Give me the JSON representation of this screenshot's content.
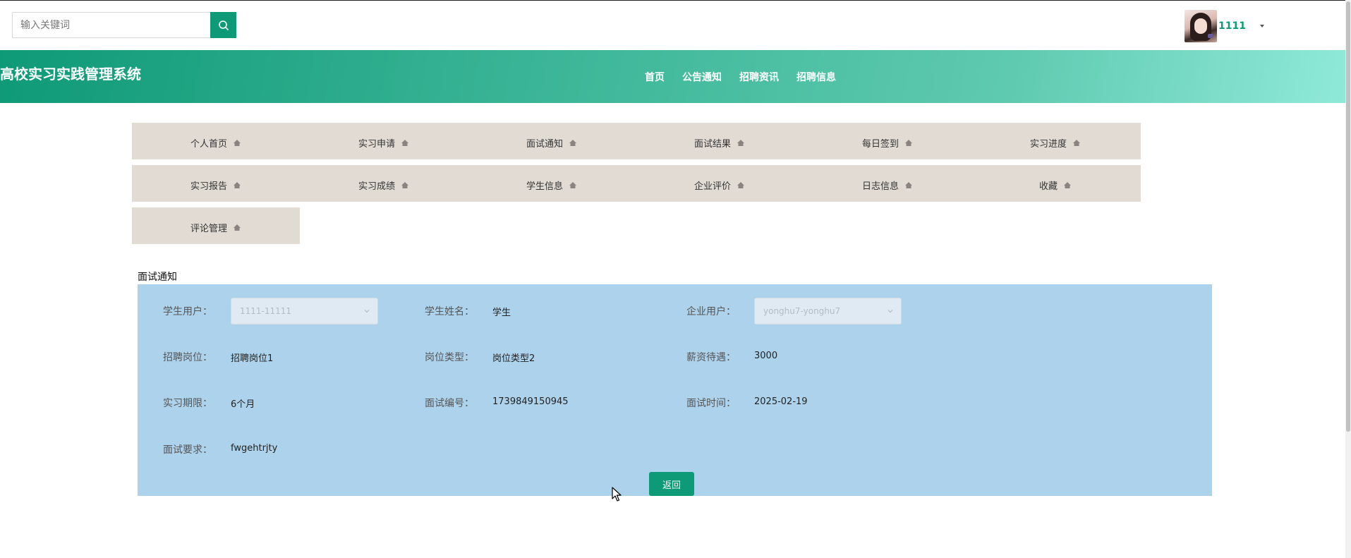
{
  "search": {
    "placeholder": "输入关键词"
  },
  "user": {
    "name": "1111"
  },
  "site": {
    "title": "高校实习实践管理系统"
  },
  "top_nav": [
    "首页",
    "公告通知",
    "招聘资讯",
    "招聘信息"
  ],
  "menu": [
    "个人首页",
    "实习申请",
    "面试通知",
    "面试结果",
    "每日签到",
    "实习进度",
    "实习报告",
    "实习成绩",
    "学生信息",
    "企业评价",
    "日志信息",
    "收藏",
    "评论管理"
  ],
  "section": {
    "title": "面试通知"
  },
  "form": {
    "student_user_label": "学生用户：",
    "student_user_value": "1111-11111",
    "student_name_label": "学生姓名：",
    "student_name_value": "学生",
    "company_user_label": "企业用户：",
    "company_user_value": "yonghu7-yonghu7",
    "position_label": "招聘岗位：",
    "position_value": "招聘岗位1",
    "position_type_label": "岗位类型：",
    "position_type_value": "岗位类型2",
    "salary_label": "薪资待遇：",
    "salary_value": "3000",
    "duration_label": "实习期限：",
    "duration_value": "6个月",
    "interview_no_label": "面试编号：",
    "interview_no_value": "1739849150945",
    "interview_time_label": "面试时间：",
    "interview_time_value": "2025-02-19",
    "requirement_label": "面试要求：",
    "requirement_value": "fwgehtrjty"
  },
  "buttons": {
    "back": "返回"
  },
  "colors": {
    "accent": "#0f9a77",
    "panel": "#add2eb",
    "menu_bg": "#e2dbd4"
  }
}
